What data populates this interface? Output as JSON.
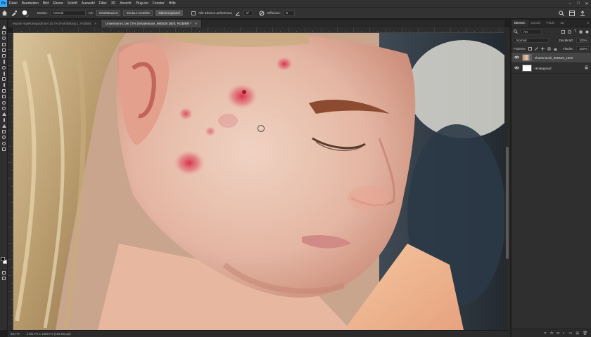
{
  "app": {
    "logo": "Ps"
  },
  "menu": [
    "Datei",
    "Bearbeiten",
    "Bild",
    "Ebene",
    "Schrift",
    "Auswahl",
    "Filter",
    "3D",
    "Ansicht",
    "Plug-ins",
    "Fenster",
    "Hilfe"
  ],
  "window_controls": {
    "minimize": "–",
    "maximize": "□",
    "close": "✕"
  },
  "options": {
    "brush_size": "17",
    "mode_label": "Modus:",
    "mode_value": "Normal",
    "type_label": "Art:",
    "type_btn1": "Inhaltsbasiert",
    "type_btn2": "Struktur erstellen",
    "type_btn3": "Näherungswert",
    "sample_all": "Alle Ebenen aufnehmen",
    "angle_value": "0°",
    "diffusion_label": "Diffusion:",
    "diffusion_value": "5"
  },
  "tabs": [
    {
      "label": "Muster stylefolioguide.bei 15,7% (Farbfüllung 1, RGB/8)",
      "close": "×",
      "active": false
    },
    {
      "label": "Unbenannt-1 bei 72% (shutterstock_980539 1920, RGB/8#) *",
      "close": "×",
      "active": true
    }
  ],
  "status": {
    "zoom": "66,7%",
    "doc_info": "2791 Px x 1866 Px (182,88 ppi)",
    "arrow": "›"
  },
  "panel": {
    "tabs": [
      "Ebenen",
      "Kanäle",
      "Pfade",
      "3D"
    ],
    "menu": "≡",
    "search_label": "Art",
    "blend_mode": "Normal",
    "opacity_label": "Deckkraft:",
    "opacity_value": "100%",
    "lock_label": "Fixieren:",
    "fill_label": "Fläche:",
    "fill_value": "100%",
    "layers": [
      {
        "name": "shutterstock_980539_1920",
        "selected": true,
        "type": "photo"
      },
      {
        "name": "Hintergrund",
        "selected": false,
        "type": "white"
      }
    ],
    "footer_icons": [
      "link-icon",
      "fx-icon",
      "mask-icon",
      "adjustment-icon",
      "group-icon",
      "new-layer-icon",
      "trash-icon"
    ]
  },
  "colors": {
    "accent": "#31a8ff",
    "chrome": "#323232",
    "panel": "#2f2f2f",
    "foreground": "#000000",
    "background": "#ffffff"
  }
}
